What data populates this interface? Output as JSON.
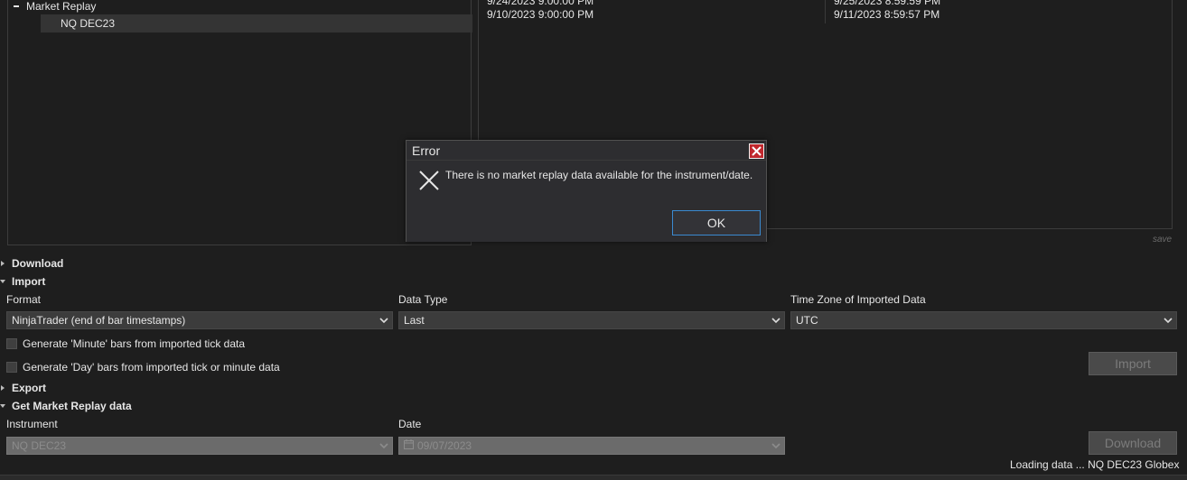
{
  "tree": {
    "root_label": "Market Replay",
    "child_label": "NQ DEC23"
  },
  "grid": {
    "rows": [
      {
        "col1": "9/24/2023 9:00:00 PM",
        "col2": "9/25/2023 8:59:59 PM"
      },
      {
        "col1": "9/10/2023 9:00:00 PM",
        "col2": "9/11/2023 8:59:57 PM"
      }
    ],
    "save_label": "save"
  },
  "sections": {
    "download": "Download",
    "import": "Import",
    "export": "Export",
    "get_replay": "Get Market Replay data"
  },
  "import": {
    "format_label": "Format",
    "format_value": "NinjaTrader (end of bar timestamps)",
    "data_type_label": "Data Type",
    "data_type_value": "Last",
    "timezone_label": "Time Zone of Imported Data",
    "timezone_value": "UTC",
    "minute_check": "Generate 'Minute' bars from imported tick data",
    "day_check": "Generate 'Day' bars from imported tick or minute data",
    "import_button": "Import"
  },
  "replay": {
    "instrument_label": "Instrument",
    "instrument_value": "NQ DEC23",
    "date_label": "Date",
    "date_value": "09/07/2023",
    "download_button": "Download",
    "status": "Loading data ... NQ DEC23 Globex"
  },
  "dialog": {
    "title": "Error",
    "message": "There is no market replay data available for the instrument/date.",
    "ok": "OK"
  },
  "colors": {
    "background": "#1e1e1e",
    "panel": "#3c3c3c",
    "accent_blue": "#3a8ad0",
    "close_red": "#c0282e"
  }
}
